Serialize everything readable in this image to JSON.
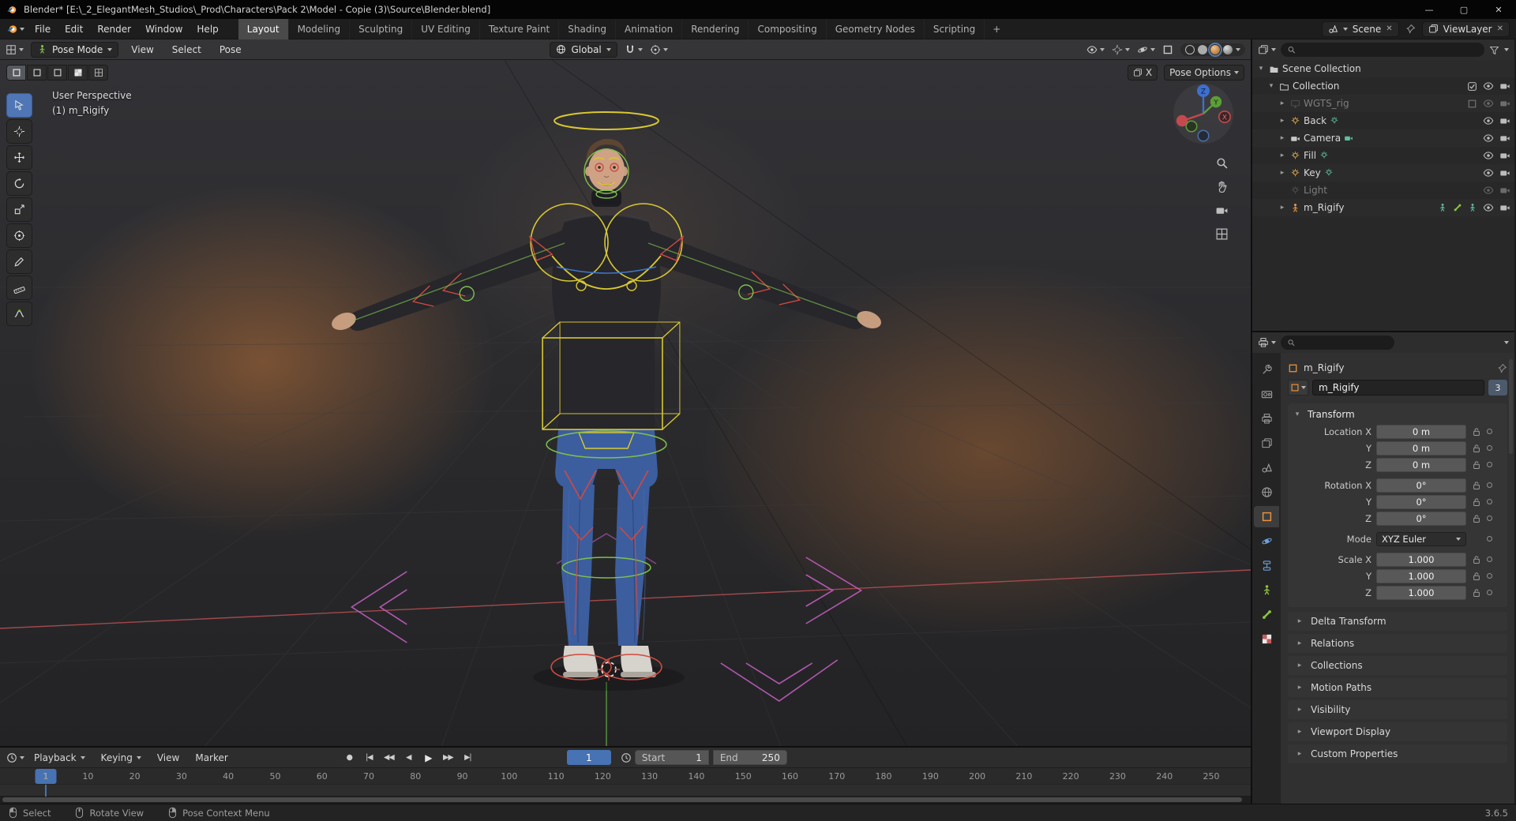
{
  "window": {
    "title": "Blender* [E:\\_2_ElegantMesh_Studios\\_Prod\\Characters\\Pack 2\\Model - Copie (3)\\Source\\Blender.blend]",
    "controls": {
      "minimize": "—",
      "maximize": "▢",
      "close": "✕"
    }
  },
  "topbar": {
    "menus": [
      "File",
      "Edit",
      "Render",
      "Window",
      "Help"
    ],
    "workspaces": [
      "Layout",
      "Modeling",
      "Sculpting",
      "UV Editing",
      "Texture Paint",
      "Shading",
      "Animation",
      "Rendering",
      "Compositing",
      "Geometry Nodes",
      "Scripting"
    ],
    "active_workspace": "Layout",
    "add_workspace": "+",
    "scene": {
      "label": "Scene"
    },
    "view_layer": {
      "label": "ViewLayer"
    }
  },
  "viewport": {
    "header": {
      "mode": "Pose Mode",
      "menus": [
        "View",
        "Select",
        "Pose"
      ],
      "orientation": "Global",
      "pose_options": "Pose Options",
      "mirror_x": "X"
    },
    "overlay": {
      "line1": "User Perspective",
      "line2": "(1) m_Rigify"
    },
    "gizmo_axes": {
      "x": "X",
      "y": "Y",
      "z": "Z"
    },
    "toolbar_tools": [
      "tweak-tool",
      "cursor-tool",
      "move-tool",
      "rotate-tool",
      "scale-tool",
      "transform-tool",
      "annotate-tool",
      "measure-tool",
      "pose-breakdowner-tool"
    ]
  },
  "outliner": {
    "title_row": "Scene Collection",
    "items": [
      {
        "label": "Collection",
        "icon": "collection-icon"
      },
      {
        "label": "WGTS_rig",
        "icon": "monitor-icon",
        "dimmed": true
      },
      {
        "label": "Back",
        "icon": "light-icon"
      },
      {
        "label": "Camera",
        "icon": "camera-icon"
      },
      {
        "label": "Fill",
        "icon": "light-icon"
      },
      {
        "label": "Key",
        "icon": "light-icon"
      },
      {
        "label": "Light",
        "icon": "light-icon",
        "dimmed": true
      },
      {
        "label": "m_Rigify",
        "icon": "armature-icon"
      }
    ]
  },
  "properties": {
    "tabs": [
      "tool",
      "render",
      "output",
      "view-layer",
      "scene",
      "world",
      "object",
      "physics",
      "constraints",
      "object-data",
      "bone",
      "texture"
    ],
    "active_tab": "object",
    "breadcrumb": "m_Rigify",
    "object_name": "m_Rigify",
    "users_count": "3",
    "transform": {
      "title": "Transform",
      "rows": [
        {
          "label": "Location X",
          "value": "0 m"
        },
        {
          "label": "Y",
          "value": "0 m"
        },
        {
          "label": "Z",
          "value": "0 m"
        },
        {
          "label": "Rotation X",
          "value": "0°"
        },
        {
          "label": "Y",
          "value": "0°"
        },
        {
          "label": "Z",
          "value": "0°"
        }
      ],
      "mode": {
        "label": "Mode",
        "value": "XYZ Euler"
      },
      "scale_rows": [
        {
          "label": "Scale X",
          "value": "1.000"
        },
        {
          "label": "Y",
          "value": "1.000"
        },
        {
          "label": "Z",
          "value": "1.000"
        }
      ]
    },
    "sections": [
      "Delta Transform",
      "Relations",
      "Collections",
      "Motion Paths",
      "Visibility",
      "Viewport Display",
      "Custom Properties"
    ]
  },
  "timeline": {
    "menus": [
      "Playback",
      "Keying",
      "View",
      "Marker"
    ],
    "current_frame": "1",
    "start": {
      "label": "Start",
      "value": "1"
    },
    "end": {
      "label": "End",
      "value": "250"
    },
    "ticks": [
      1,
      10,
      20,
      30,
      40,
      50,
      60,
      70,
      80,
      90,
      100,
      110,
      120,
      130,
      140,
      150,
      160,
      170,
      180,
      190,
      200,
      210,
      220,
      230,
      240,
      250
    ],
    "transport": [
      {
        "name": "record",
        "glyph": "●"
      },
      {
        "name": "jump-to-start",
        "glyph": "|◀"
      },
      {
        "name": "previous-keyframe",
        "glyph": "◀◀"
      },
      {
        "name": "play-reverse",
        "glyph": "◀"
      },
      {
        "name": "play",
        "glyph": "▶"
      },
      {
        "name": "next-keyframe",
        "glyph": "▶▶"
      },
      {
        "name": "jump-to-end",
        "glyph": "▶|"
      }
    ]
  },
  "statusbar": {
    "hints": [
      "Select",
      "Rotate View",
      "Pose Context Menu"
    ],
    "version": "3.6.5"
  },
  "colors": {
    "accent_blue": "#4772b3",
    "blender_orange": "#e8913f",
    "rig_yellow": "#d9c832",
    "rig_green": "#7ec14d",
    "rig_red": "#d24a3e",
    "rig_magenta": "#c35ec0"
  }
}
